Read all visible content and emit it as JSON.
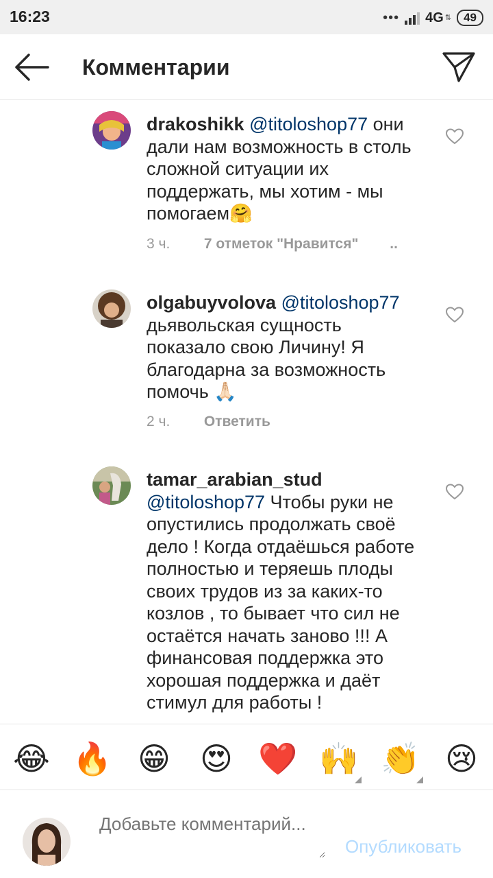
{
  "status_bar": {
    "time": "16:23",
    "dots": "•••",
    "network": "4G",
    "network_arrows": "⇅",
    "battery": "49"
  },
  "header": {
    "title": "Комментарии",
    "back_icon": "arrow-left-icon",
    "send_icon": "paper-plane-icon"
  },
  "comments": [
    {
      "username": "drakoshikk",
      "mention": "@titoloshop77",
      "text": " они дали нам возможность в столь сложной ситуации их поддержать, мы хотим - мы помогаем🤗",
      "time": "3 ч.",
      "likes": "7 отметок \"Нравится\"",
      "more": ".."
    },
    {
      "username": "olgabuyvolova",
      "mention": "@titoloshop77",
      "text": " дьявольская сущность показало свою Личину! Я благодарна за возможность помочь 🙏🏻",
      "time": "2 ч.",
      "reply": "Ответить"
    },
    {
      "username": "tamar_arabian_stud",
      "mention": "@titoloshop77",
      "text": " Чтобы руки не опустились продолжать своё дело ! Когда отдаёшься работе полностью и теряешь плоды своих трудов из за каких-то козлов , то бывает что сил не остаётся начать заново !!! А финансовая поддержка это хорошая поддержка и даёт стимул для работы !"
    }
  ],
  "emoji_bar": {
    "items": [
      "😂",
      "🔥",
      "😁",
      "😍",
      "❤️",
      "🙌",
      "👏",
      "😢"
    ]
  },
  "compose": {
    "placeholder": "Добавьте комментарий...",
    "publish": "Опубликовать"
  },
  "colors": {
    "mention": "#003569",
    "meta": "#999999",
    "publish_disabled": "#b3dbff"
  }
}
